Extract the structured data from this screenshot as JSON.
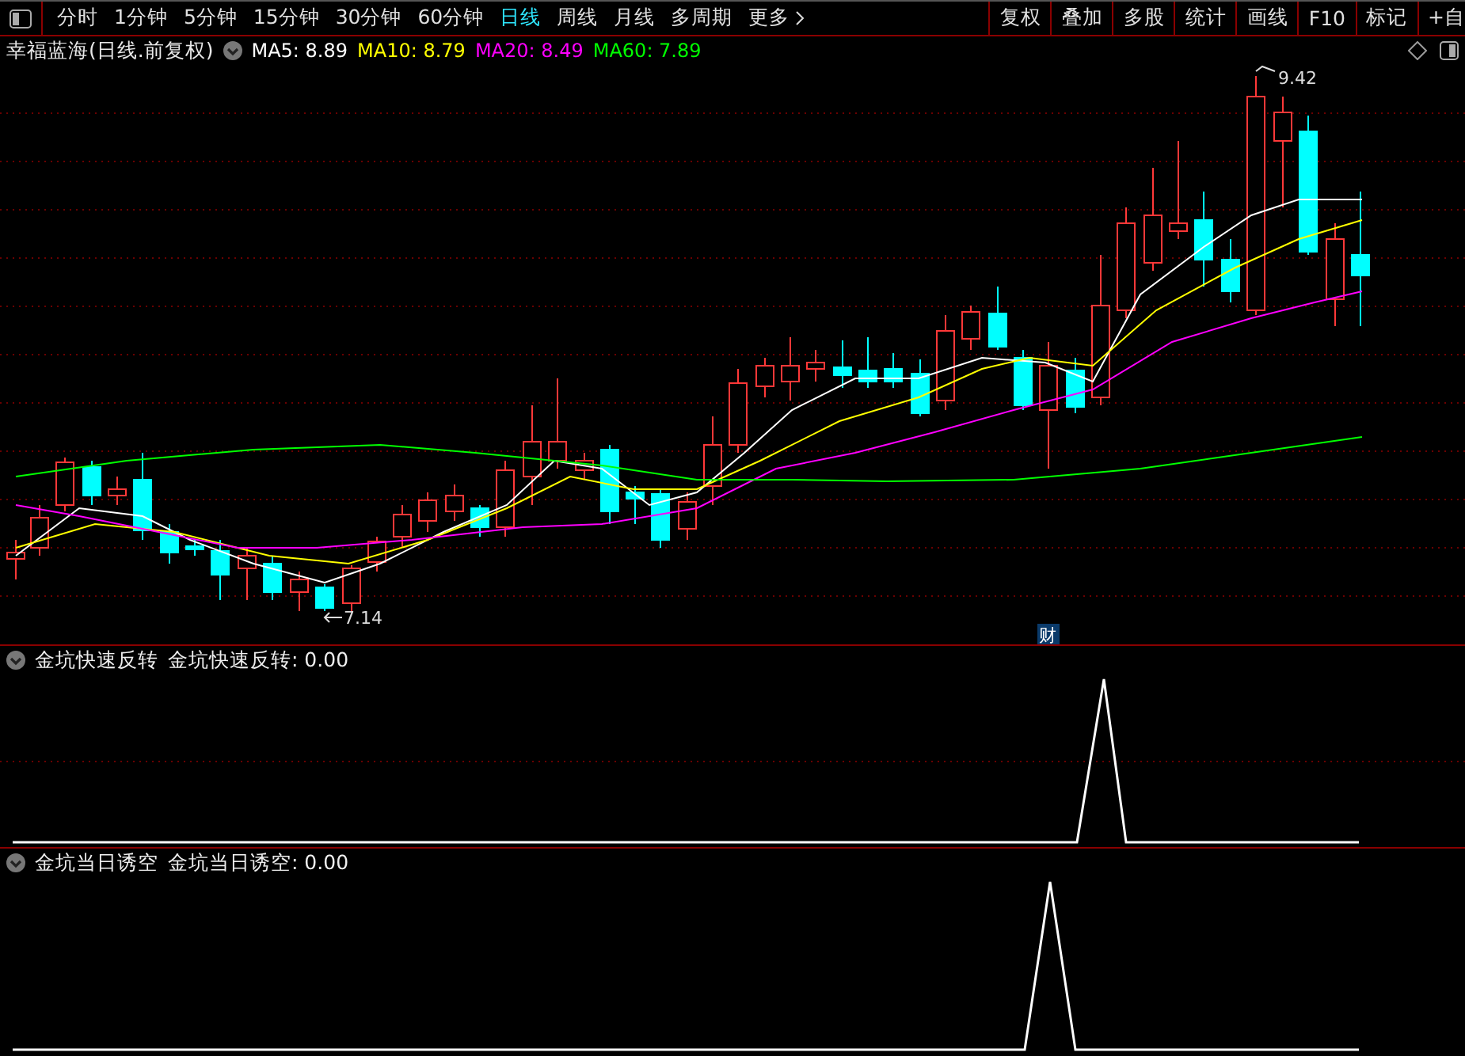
{
  "toolbar": {
    "periods": [
      {
        "label": "分时",
        "selected": false
      },
      {
        "label": "1分钟",
        "selected": false
      },
      {
        "label": "5分钟",
        "selected": false
      },
      {
        "label": "15分钟",
        "selected": false
      },
      {
        "label": "30分钟",
        "selected": false
      },
      {
        "label": "60分钟",
        "selected": false
      },
      {
        "label": "日线",
        "selected": true
      },
      {
        "label": "周线",
        "selected": false
      },
      {
        "label": "月线",
        "selected": false
      },
      {
        "label": "多周期",
        "selected": false
      },
      {
        "label": "更多",
        "selected": false
      }
    ],
    "buttons": [
      "复权",
      "叠加",
      "多股",
      "统计",
      "画线",
      "F10",
      "标记",
      "+自"
    ]
  },
  "legend": {
    "title": "幸福蓝海(日线.前复权)",
    "ma": [
      {
        "label": "MA5: 8.89",
        "color": "#ffffff"
      },
      {
        "label": "MA10: 8.79",
        "color": "#ffff00"
      },
      {
        "label": "MA20: 8.49",
        "color": "#ff00ff"
      },
      {
        "label": "MA60: 7.89",
        "color": "#00ff00"
      }
    ]
  },
  "chart": {
    "high_label": "9.42",
    "low_label": "7.14",
    "badge": "财"
  },
  "indicators": [
    {
      "name": "金坑快速反转",
      "reading": "金坑快速反转: 0.00"
    },
    {
      "name": "金坑当日诱空",
      "reading": "金坑当日诱空: 0.00"
    }
  ]
}
